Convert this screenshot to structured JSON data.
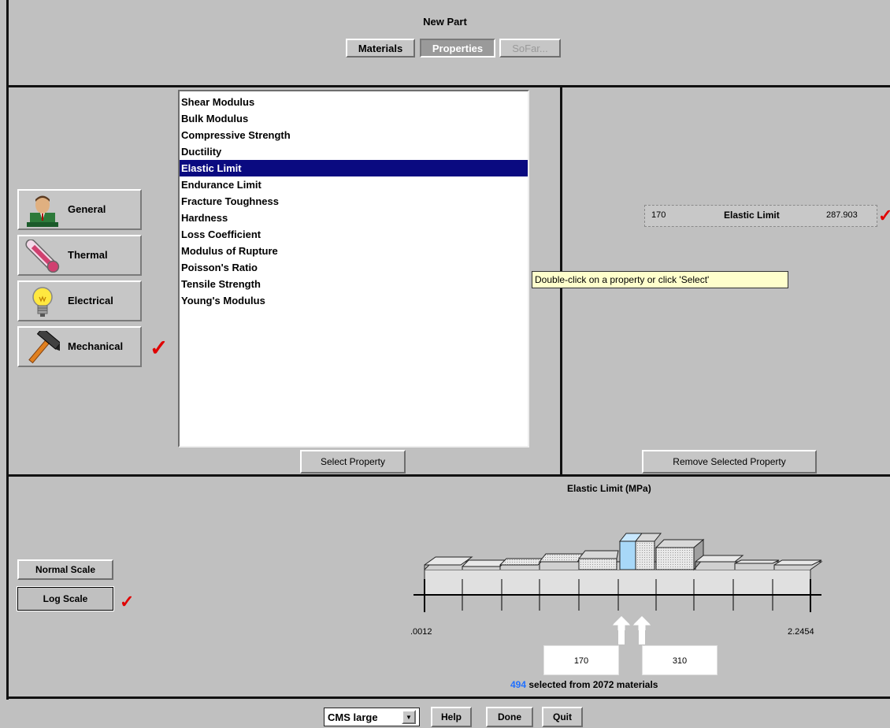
{
  "window": {
    "title": "New Part"
  },
  "tabs": [
    {
      "label": "Materials"
    },
    {
      "label": "Properties"
    },
    {
      "label": "SoFar..."
    }
  ],
  "categories": [
    {
      "label": "General",
      "icon": "person-icon"
    },
    {
      "label": "Thermal",
      "icon": "thermometer-icon"
    },
    {
      "label": "Electrical",
      "icon": "lightbulb-icon"
    },
    {
      "label": "Mechanical",
      "icon": "hammer-icon",
      "checked": true
    }
  ],
  "property_list": {
    "items": [
      "Shear Modulus",
      "Bulk Modulus",
      "Compressive Strength",
      "Ductility",
      "Elastic Limit",
      "Endurance Limit",
      "Fracture Toughness",
      "Hardness",
      "Loss Coefficient",
      "Modulus of Rupture",
      "Poisson's Ratio",
      "Tensile Strength",
      "Young's Modulus"
    ],
    "selected": "Elastic Limit",
    "select_button": "Select Property"
  },
  "tooltip": "Double-click on a property or click 'Select'",
  "selected_property": {
    "min": "170",
    "name": "Elastic Limit",
    "max": "287.903"
  },
  "remove_button": "Remove Selected Property",
  "histogram": {
    "title": "Elastic Limit (MPa)",
    "axis_min_label": ".0012",
    "axis_max_label": "2.2454",
    "lower_value": "170",
    "upper_value": "310",
    "count_selected": "494",
    "count_text": "selected from 2072 materials"
  },
  "scale": {
    "normal_label": "Normal Scale",
    "log_label": "Log Scale",
    "active": "Log Scale"
  },
  "footer": {
    "database": "CMS large",
    "help": "Help",
    "done": "Done",
    "quit": "Quit"
  },
  "colors": {
    "background": "#c0c0c0",
    "selection": "#0a0a80",
    "checkmark": "#e00000",
    "highlight_bar": "#a8d8f8",
    "count_blue": "#2070ff"
  }
}
